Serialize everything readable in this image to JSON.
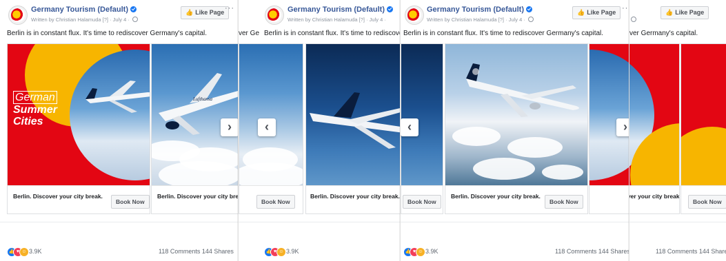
{
  "post": {
    "page_name": "Germany Tourism (Default)",
    "byline": "Written by Christian Halamuda [?] · July 4 · ",
    "like_label": "Like Page",
    "more": "···",
    "text": "Berlin is in constant flux. It's time to rediscover Germany's capital.",
    "text_frag_1": "ver Ge",
    "text_frag_2": "ver Germany's capital."
  },
  "cards": {
    "caption": "Berlin. Discover your city break.",
    "cta": "Book Now",
    "promo_lines": [
      "German",
      "Summer",
      "Cities"
    ],
    "livery": "Lufthansa"
  },
  "engagement": {
    "reactions_count": "3.9K",
    "comments": "118 Comments",
    "shares": "144 Shares",
    "reaction_icons": [
      "like-icon",
      "love-icon",
      "haha-icon"
    ]
  },
  "nav": {
    "next": "›",
    "prev": "‹"
  },
  "colors": {
    "brand_red": "#e30613",
    "brand_yellow": "#f7b500",
    "fb_blue": "#385898",
    "lh_navy": "#0a1d3d"
  }
}
